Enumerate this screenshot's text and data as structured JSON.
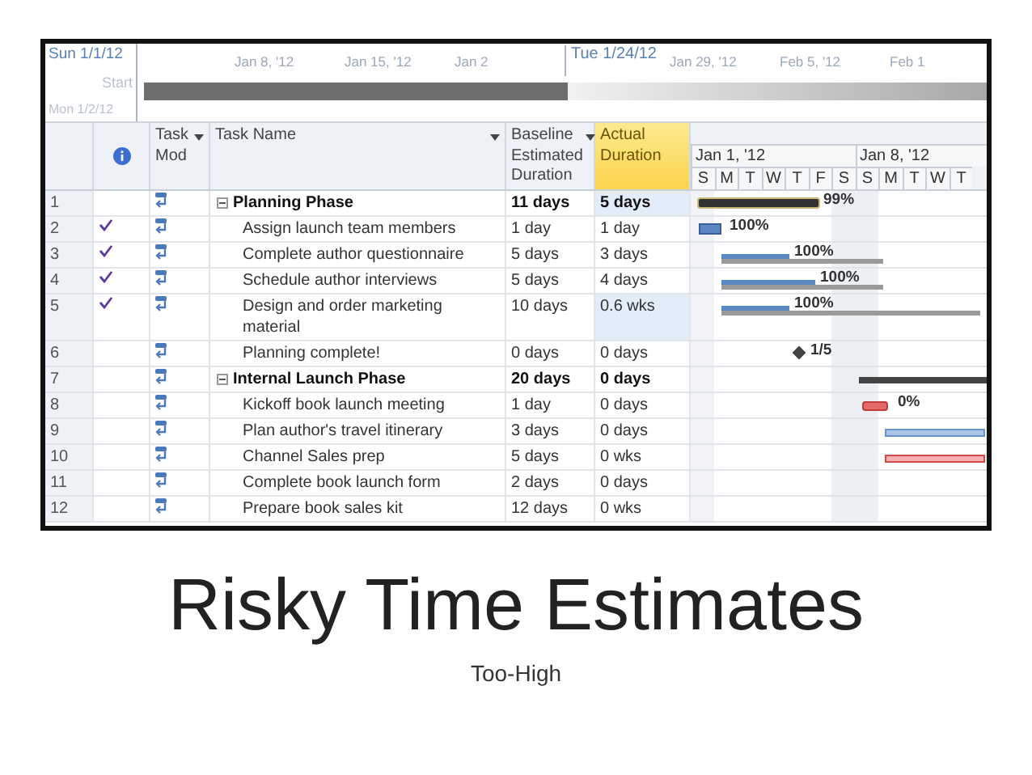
{
  "timeline": {
    "start_date": "Sun 1/1/12",
    "start_label": "Start",
    "start_sub": "Mon 1/2/12",
    "dates": [
      {
        "label": "Jan 8, '12",
        "kind": "tick"
      },
      {
        "label": "Jan 15, '12",
        "kind": "tick"
      },
      {
        "label": "Jan 2",
        "kind": "tick"
      },
      {
        "label": "Tue 1/24/12",
        "kind": "marker"
      },
      {
        "label": "Jan 29, '12",
        "kind": "tick"
      },
      {
        "label": "Feb 5, '12",
        "kind": "tick"
      },
      {
        "label": "Feb 1",
        "kind": "tick"
      }
    ]
  },
  "table": {
    "columns": [
      {
        "kind": "indicator",
        "filter": false,
        "selected": false
      },
      {
        "kind": "mode",
        "label": "Task Mod",
        "filter": true,
        "selected": false
      },
      {
        "kind": "name",
        "label": "Task Name",
        "filter": true,
        "selected": false
      },
      {
        "kind": "baseline",
        "label": "Baseline Estimated Duration",
        "filter": true,
        "selected": false
      },
      {
        "kind": "actual",
        "label": "Actual Duration",
        "filter": false,
        "selected": true
      }
    ],
    "rows": [
      {
        "id": "1",
        "name": "Planning Phase",
        "baseline": "11 days",
        "actual": "5 days",
        "done": false,
        "expanded": true,
        "actual_highlighted": true,
        "gantt_label": "99%",
        "children": [
          {
            "id": "2",
            "name": "Assign launch team members",
            "baseline": "1 day",
            "actual": "1 day",
            "done": true,
            "actual_highlighted": false,
            "gantt_label": "100%"
          },
          {
            "id": "3",
            "name": "Complete author questionnaire",
            "baseline": "5 days",
            "actual": "3 days",
            "done": true,
            "actual_highlighted": false,
            "gantt_label": "100%"
          },
          {
            "id": "4",
            "name": "Schedule author interviews",
            "baseline": "5 days",
            "actual": "4 days",
            "done": true,
            "actual_highlighted": false,
            "gantt_label": "100%"
          },
          {
            "id": "5",
            "name": "Design and order marketing material",
            "baseline": "10 days",
            "actual": "0.6 wks",
            "done": true,
            "actual_highlighted": true,
            "gantt_label": "100%"
          },
          {
            "id": "6",
            "name": "Planning complete!",
            "baseline": "0 days",
            "actual": "0 days",
            "done": false,
            "actual_highlighted": false,
            "gantt_label": "1/5"
          }
        ]
      },
      {
        "id": "7",
        "name": "Internal Launch Phase",
        "baseline": "20 days",
        "actual": "0 days",
        "done": false,
        "expanded": true,
        "actual_highlighted": false,
        "children": [
          {
            "id": "8",
            "name": "Kickoff book launch meeting",
            "baseline": "1 day",
            "actual": "0 days",
            "done": false,
            "actual_highlighted": false,
            "gantt_label": "0%"
          },
          {
            "id": "9",
            "name": "Plan author's travel itinerary",
            "baseline": "3 days",
            "actual": "0 days",
            "done": false,
            "actual_highlighted": false
          },
          {
            "id": "10",
            "name": "Channel Sales prep",
            "baseline": "5 days",
            "actual": "0 wks",
            "done": false,
            "actual_highlighted": false
          },
          {
            "id": "11",
            "name": "Complete book launch form",
            "baseline": "2 days",
            "actual": "0 days",
            "done": false,
            "actual_highlighted": false
          },
          {
            "id": "12",
            "name": "Prepare book sales kit",
            "baseline": "12 days",
            "actual": "0 wks",
            "done": false,
            "actual_highlighted": false
          }
        ]
      }
    ]
  },
  "gantt": {
    "weeks": [
      "Jan 1, '12",
      "Jan 8, '12"
    ],
    "days": [
      "S",
      "M",
      "T",
      "W",
      "T",
      "F",
      "S",
      "S",
      "M",
      "T",
      "W",
      "T"
    ]
  },
  "slide": {
    "title": "Risky Time Estimates",
    "subtitle": "Too-High"
  }
}
